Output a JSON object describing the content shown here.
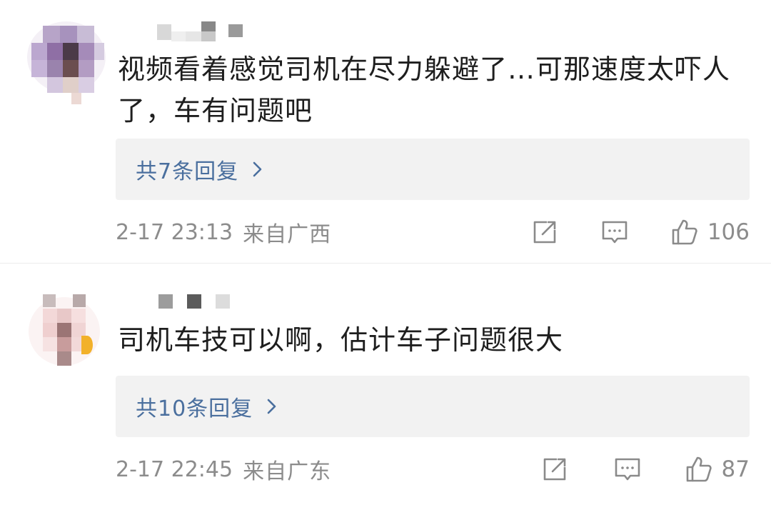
{
  "comments": [
    {
      "text": "视频看着感觉司机在尽力躲避了…可那速度太吓人了，车有问题吧",
      "replies_label": "共7条回复",
      "timestamp": "2-17 23:13",
      "location": "来自广西",
      "likes": "106"
    },
    {
      "text": "司机车技可以啊，估计车子问题很大",
      "replies_label": "共10条回复",
      "timestamp": "2-17 22:45",
      "location": "来自广东",
      "likes": "87"
    }
  ],
  "icons": {
    "share": "share-icon",
    "comment": "comment-icon",
    "like": "thumbs-up-icon",
    "chevron": "chevron-right-icon"
  },
  "colors": {
    "text": "#1e1e1e",
    "link": "#4a6f9e",
    "meta": "#8c8c8c",
    "reply_bg": "#f2f2f2"
  }
}
